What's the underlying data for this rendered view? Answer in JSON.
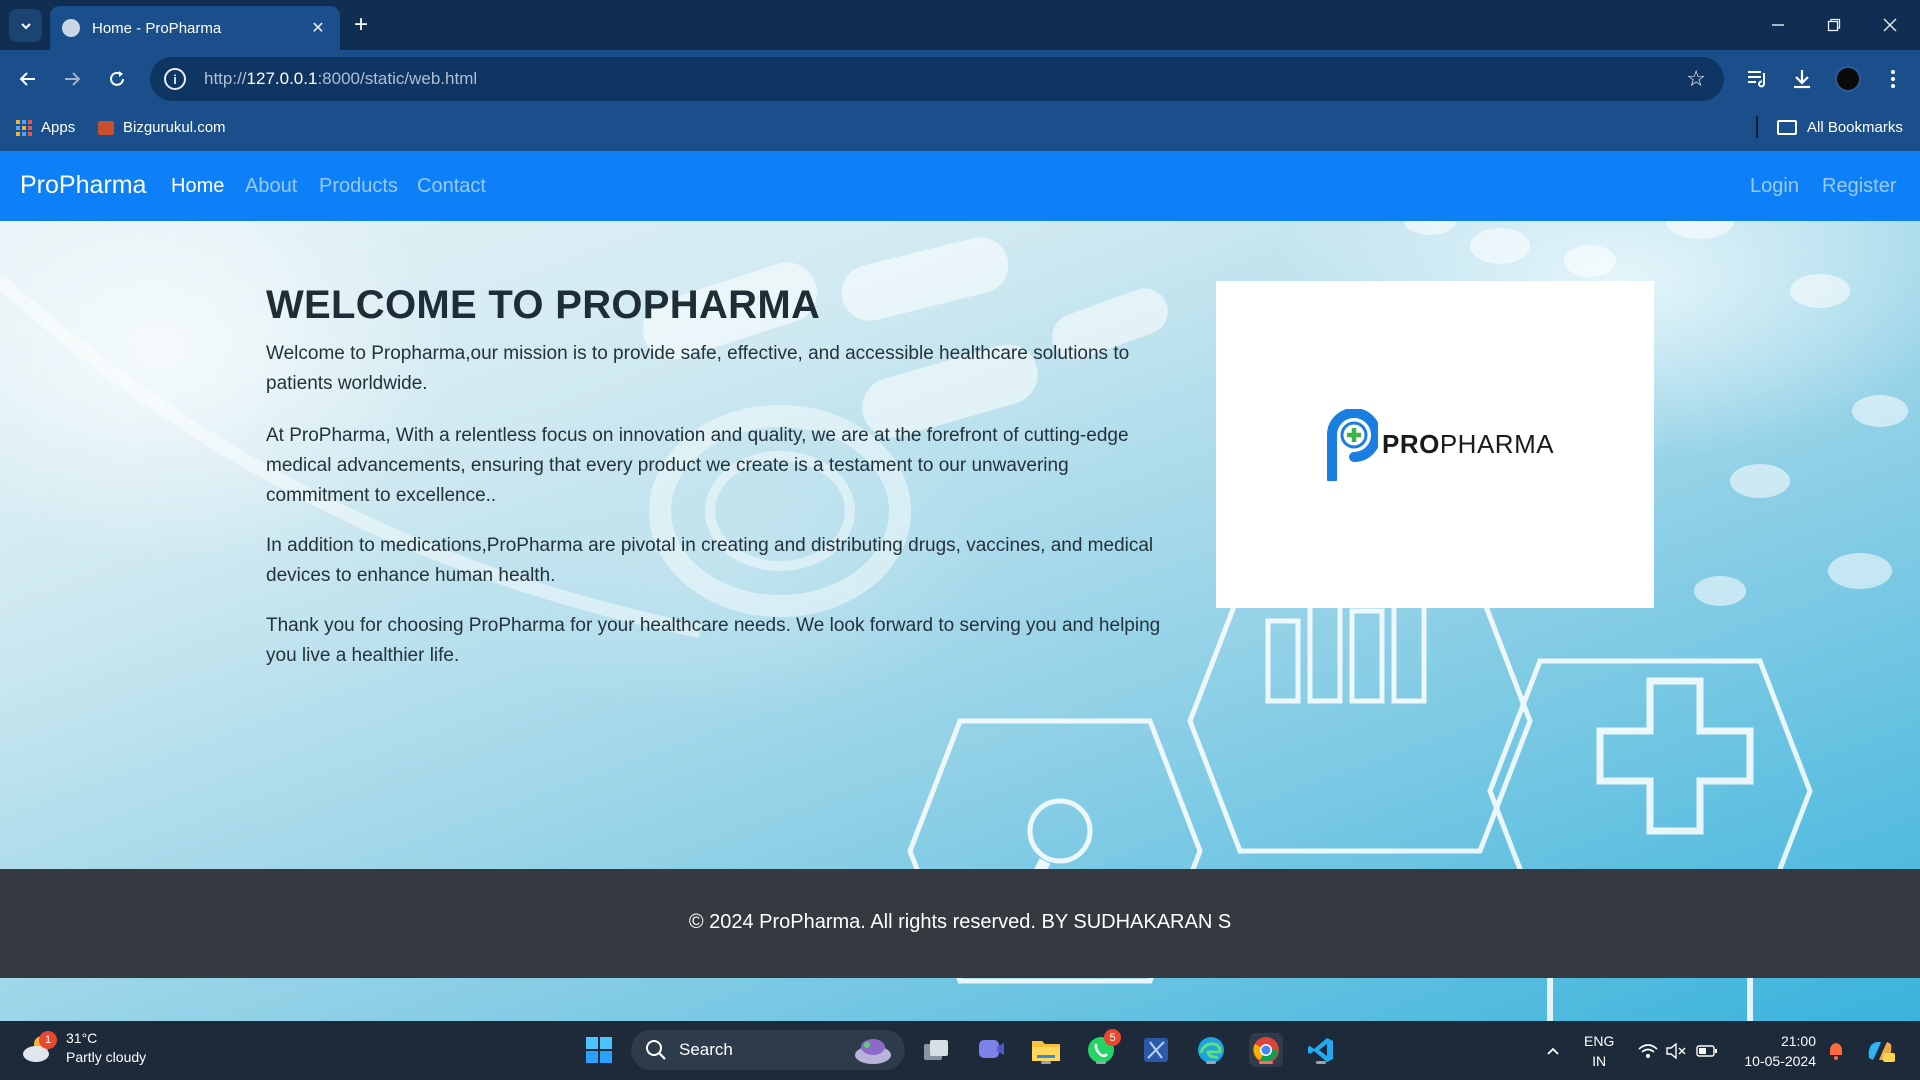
{
  "browser": {
    "tab_title": "Home - ProPharma",
    "url_scheme": "http://",
    "url_host": "127.0.0.1",
    "url_rest": ":8000/static/web.html",
    "bookmarks": [
      {
        "label": "Apps"
      },
      {
        "label": "Bizgurukul.com"
      }
    ],
    "all_bookmarks_label": "All Bookmarks"
  },
  "site": {
    "brand": "ProPharma",
    "nav": [
      {
        "label": "Home",
        "active": true
      },
      {
        "label": "About",
        "active": false
      },
      {
        "label": "Products",
        "active": false
      },
      {
        "label": "Contact",
        "active": false
      }
    ],
    "auth": {
      "login": "Login",
      "register": "Register"
    },
    "hero": {
      "title": "WELCOME TO PROPHARMA",
      "paragraphs": [
        "Welcome to Propharma,our mission is to provide safe, effective, and accessible healthcare solutions to patients worldwide.",
        "At ProPharma, With a relentless focus on innovation and quality, we are at the forefront of cutting-edge medical advancements, ensuring that every product we create is a testament to our unwavering commitment to excellence..",
        "In addition to medications,ProPharma are pivotal in creating and distributing drugs, vaccines, and medical devices to enhance human health.",
        "Thank you for choosing ProPharma for your healthcare needs. We look forward to serving you and helping you live a healthier life."
      ]
    },
    "logo": {
      "text_bold": "PRO",
      "text_rest": "PHARMA"
    },
    "footer": "© 2024 ProPharma. All rights reserved. BY SUDHAKARAN S"
  },
  "taskbar": {
    "weather": {
      "temp": "31°C",
      "condition": "Partly cloudy",
      "badge": "1"
    },
    "search_label": "Search",
    "whatsapp_badge": "5",
    "lang_top": "ENG",
    "lang_bottom": "IN",
    "time": "21:00",
    "date": "10-05-2024"
  },
  "colors": {
    "site_nav": "#0d7ff7",
    "footer": "#343a40",
    "browser_frame": "#1a4f8c",
    "logo_accent": "#1a7de0",
    "logo_plus": "#3cb44a"
  }
}
